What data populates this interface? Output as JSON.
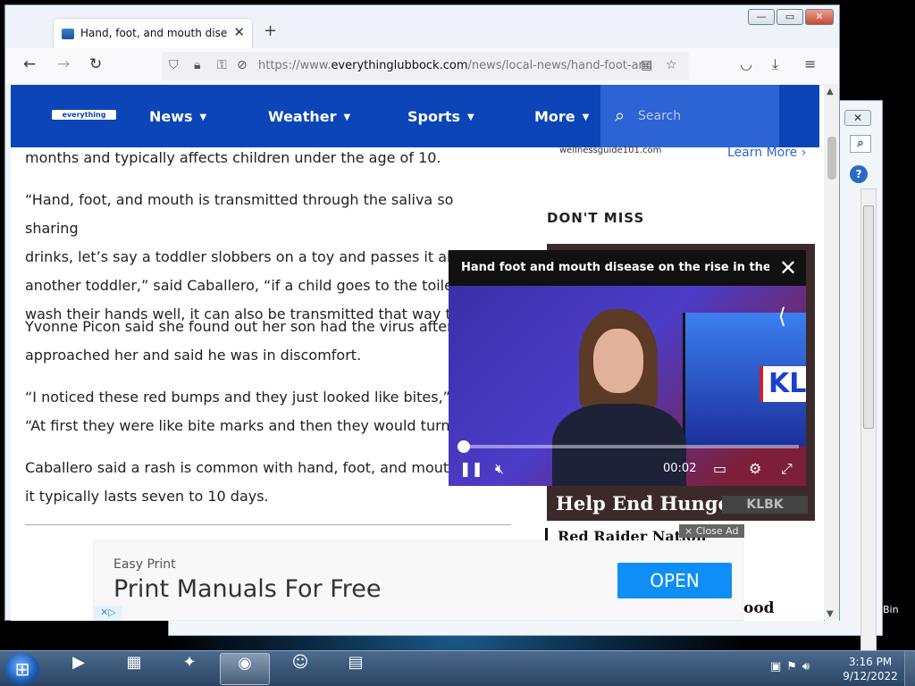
{
  "browser": {
    "tab_title": "Hand, foot, and mouth disease",
    "tab_close": "✕",
    "new_tab": "+",
    "url_prefix": "https://www.",
    "url_domain": "everythinglubbock.com",
    "url_path": "/news/local-news/hand-foot-and-mouth",
    "window_controls": {
      "minimize": "—",
      "maximize": "▭",
      "close": "✕"
    }
  },
  "site": {
    "logo": "everything lubbock",
    "menu": [
      {
        "label": "News"
      },
      {
        "label": "Weather"
      },
      {
        "label": "Sports"
      },
      {
        "label": "More"
      }
    ],
    "caret": "▼",
    "search_placeholder": "Search"
  },
  "article": {
    "paragraphs": [
      [
        "months and typically affects children under the age of 10."
      ],
      [
        "“Hand, foot, and mouth is transmitted through the saliva so sharing",
        "drinks, let’s say a toddler slobbers on a toy and passes it along to",
        "another toddler,” said Caballero, “if a child goes to the toilet and",
        "wash their hands well, it can also be transmitted that way too.”"
      ],
      [
        "Yvonne Picon said she found out her son had the virus after he",
        "approached her and said he was in discomfort."
      ],
      [
        "“I noticed these red bumps and they just looked like bites,” said",
        "“At first they were like bite marks and then they would turn into"
      ],
      [
        "Caballero said a rash is common with hand, foot, and mouth dis",
        "it typically lasts seven to 10 days."
      ]
    ]
  },
  "sidebar": {
    "wellness_source": "wellnessguide101.com",
    "learn_more": "Learn More ›",
    "dont_miss": "DON'T MISS",
    "promo_text": "Help End Hunger",
    "promo_brand": "KLBK",
    "story_title": "Red Raider Nation",
    "story_fragment": "ood"
  },
  "video": {
    "title": "Hand foot and mouth disease on the rise in the ...",
    "close": "✕",
    "time": "00:02",
    "progress": 0.0,
    "brand_overlay": "KL"
  },
  "ad": {
    "close_ad": "× Close Ad",
    "brand": "Easy Print",
    "headline": "Print Manuals For Free",
    "cta": "OPEN",
    "cta_color": "#0f8ff5"
  },
  "taskbar": {
    "time": "3:16 PM",
    "date": "9/12/2022",
    "recycle_bin_label": "Bin"
  },
  "colors": {
    "site_nav": "#0b45b8",
    "search_bg": "#2c64d6"
  }
}
